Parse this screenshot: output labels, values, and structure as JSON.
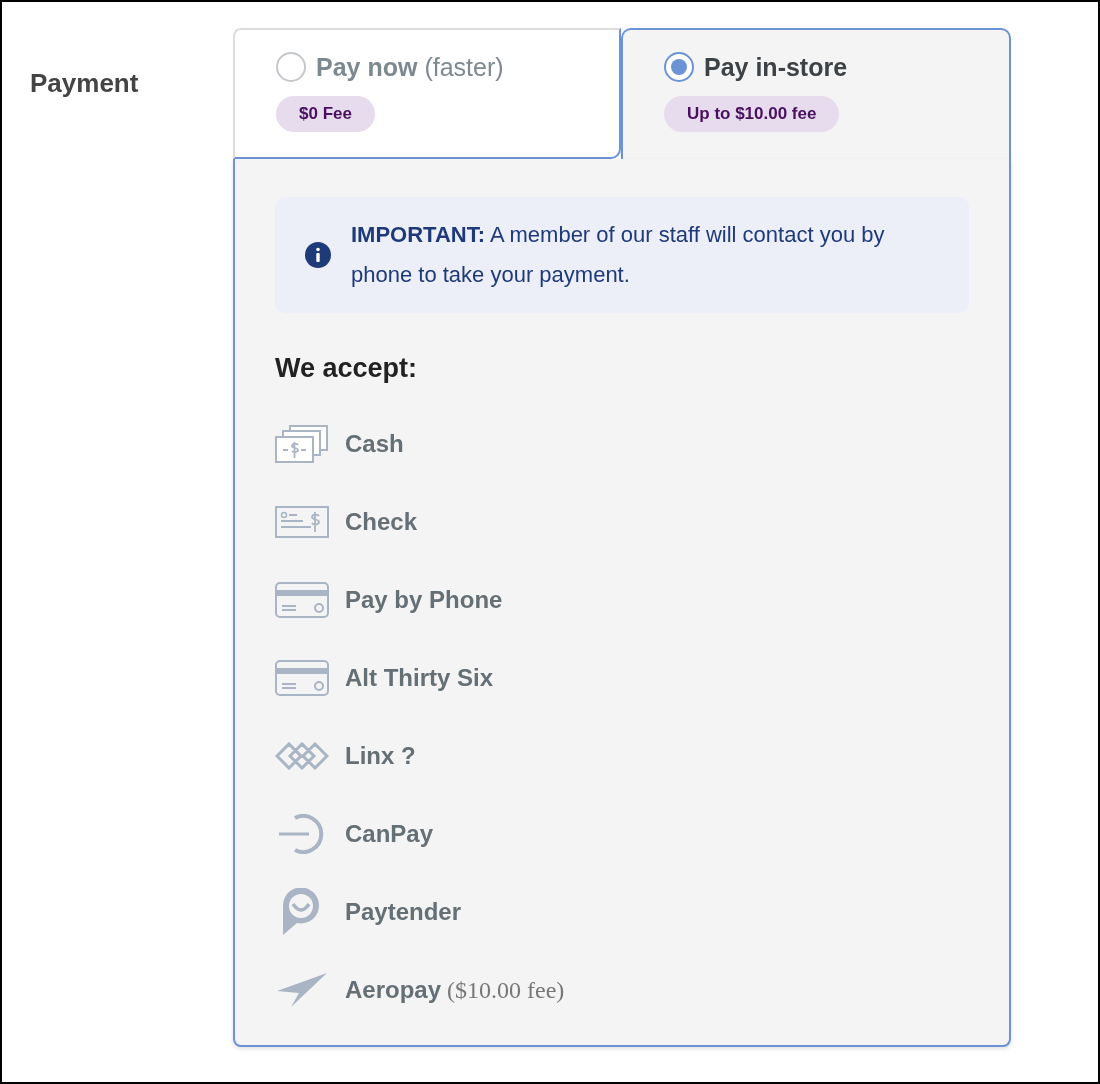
{
  "section_label": "Payment",
  "tabs": [
    {
      "label": "Pay now",
      "note": "(faster)",
      "badge": "$0 Fee",
      "selected": false
    },
    {
      "label": "Pay in-store",
      "badge": "Up to $10.00 fee",
      "selected": true
    }
  ],
  "notice": "**IMPORTANT:**  A member of our staff will contact you by phone to take your payment.",
  "heading": "We accept:",
  "methods": [
    {
      "kind": "cash",
      "label": "Cash"
    },
    {
      "kind": "check",
      "label": "Check"
    },
    {
      "kind": "card",
      "label": "Pay by Phone"
    },
    {
      "kind": "card",
      "label": "Alt Thirty Six"
    },
    {
      "kind": "linx",
      "label": "Linx ?"
    },
    {
      "kind": "canpay",
      "label": "CanPay"
    },
    {
      "kind": "paytender",
      "label": "Paytender"
    },
    {
      "kind": "aeropay",
      "label": "Aeropay",
      "note": "($10.00 fee)"
    }
  ]
}
